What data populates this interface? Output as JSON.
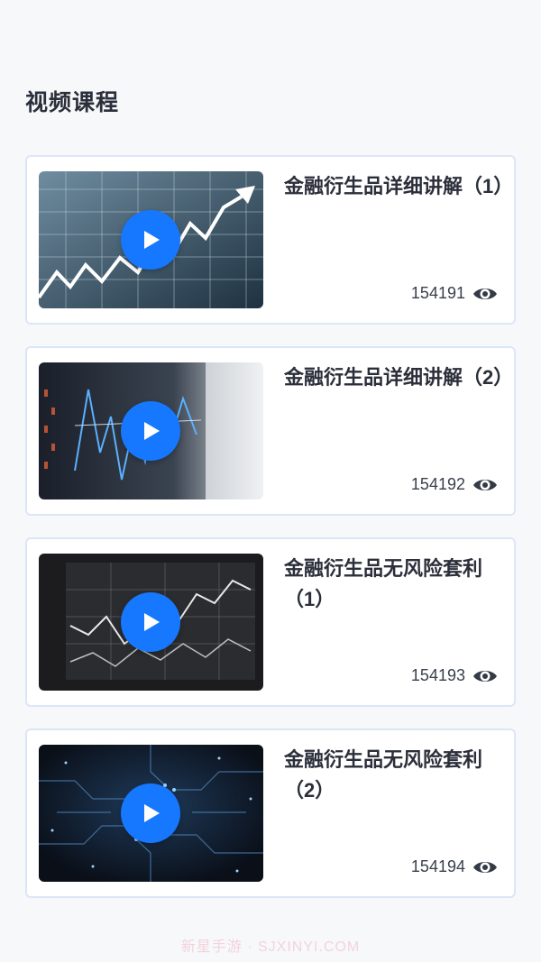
{
  "header": {
    "title": "视频课程"
  },
  "courses": [
    {
      "title": "金融衍生品详细讲解（1）",
      "views": "154191",
      "thumbnail": "rising-chart-grid"
    },
    {
      "title": "金融衍生品详细讲解（2）",
      "views": "154192",
      "thumbnail": "trading-screen-candles"
    },
    {
      "title": "金融衍生品无风险套利（1）",
      "views": "154193",
      "thumbnail": "stock-monitor-lines"
    },
    {
      "title": "金融衍生品无风险套利（2）",
      "views": "154194",
      "thumbnail": "circuit-board"
    }
  ],
  "icons": {
    "play": "play-icon",
    "views": "eye-icon"
  },
  "colors": {
    "accent": "#1677ff",
    "card_border": "#dbe6f7",
    "text": "#2b2f3a"
  },
  "watermark": "新星手游 · SJXINYI.COM"
}
